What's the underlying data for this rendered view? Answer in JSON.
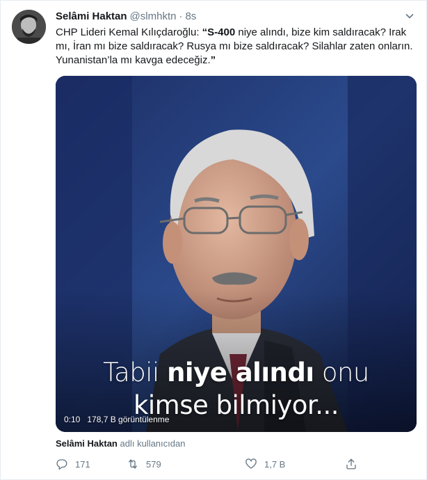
{
  "tweet": {
    "author_name": "Selâmi Haktan",
    "handle": "@slmhktn",
    "separator": "·",
    "time": "8s",
    "text_prefix": "CHP Lideri Kemal Kılıçdaroğlu: ",
    "text_bold_1": "“S-400",
    "text_mid": " niye alındı, bize kim saldıracak? Irak mı, İran mı bize saldıracak? Rusya mı bize saldıracak? Silahlar zaten onların. Yunanistan’la mı kavga edeceğiz.",
    "text_bold_2": "”"
  },
  "video": {
    "caption_line1_a": "Tabii ",
    "caption_line1_b": "niye alındı",
    "caption_line1_c": " onu",
    "caption_line2": "kimse bilmiyor...",
    "duration": "0:10",
    "views": "178,7 B görüntülenme"
  },
  "attribution": {
    "user": "Selâmi Haktan",
    "suffix": "adlı kullanıcıdan"
  },
  "actions": {
    "reply_count": "171",
    "retweet_count": "579",
    "like_count": "1,7 B"
  },
  "colors": {
    "text": "#14171a",
    "muted": "#657786",
    "border": "#e6ecf0",
    "video_bg": "#1a2a55"
  }
}
